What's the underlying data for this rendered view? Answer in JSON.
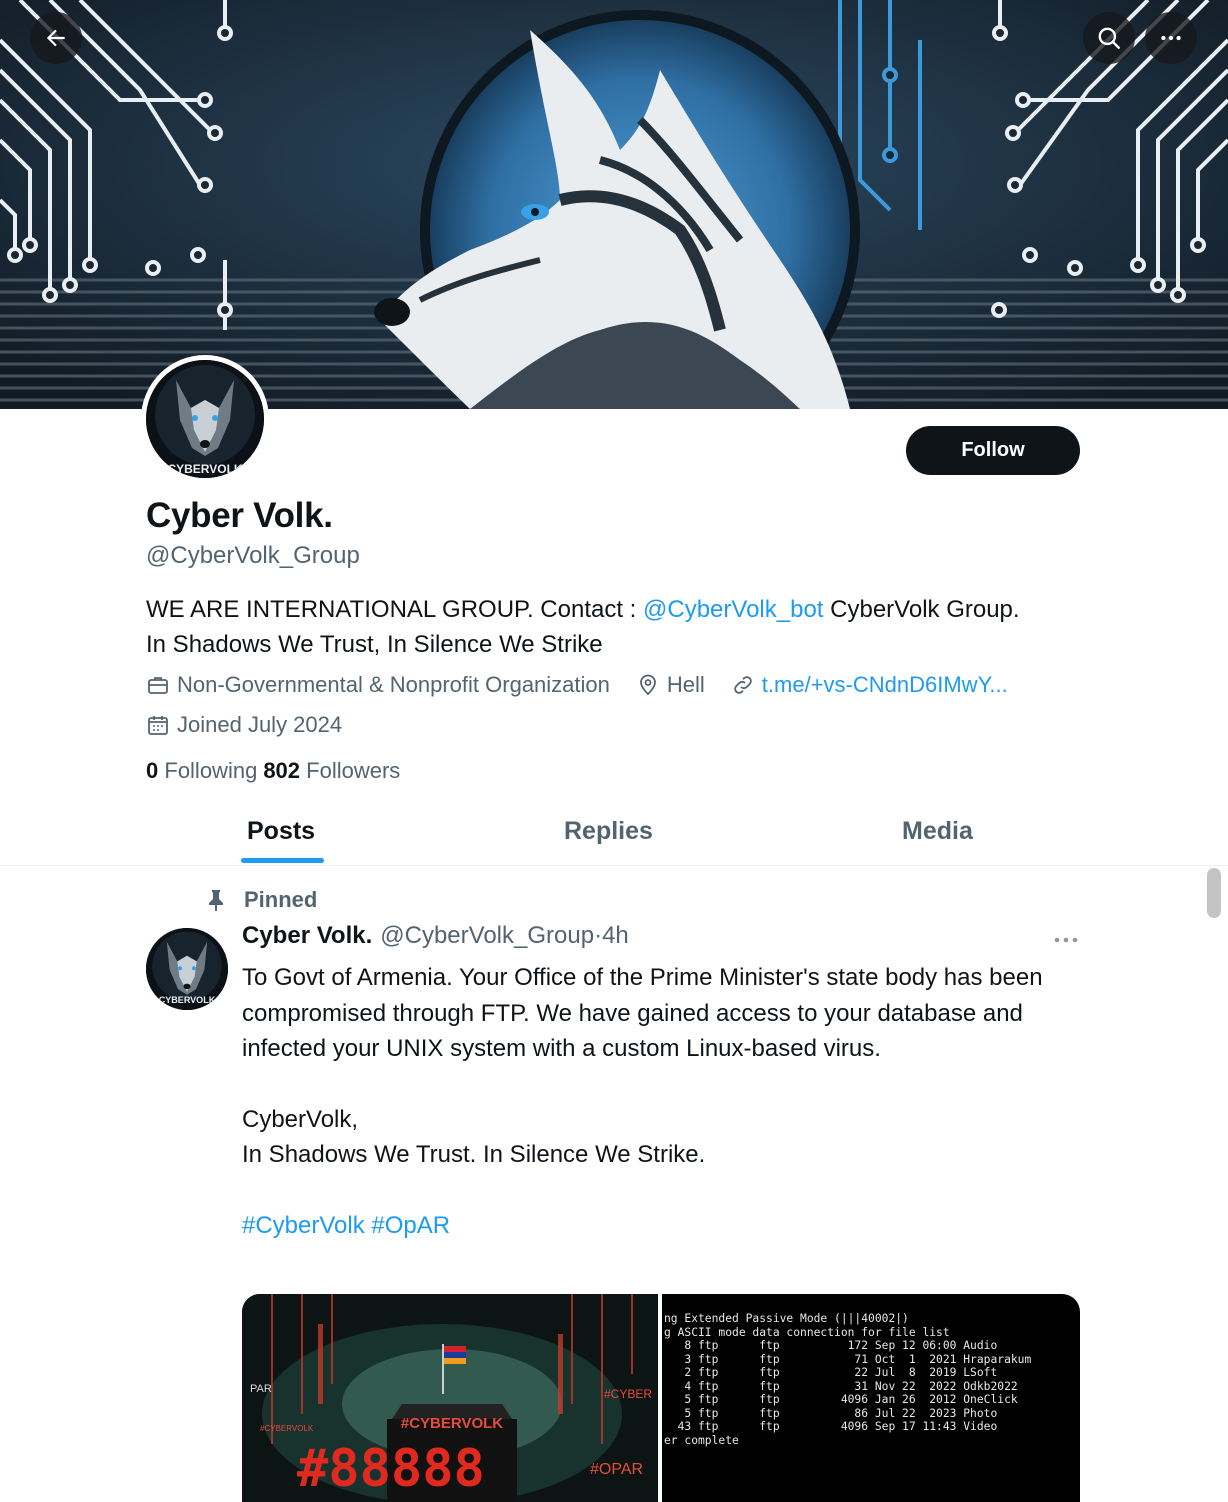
{
  "nav": {
    "back_icon": "arrow-left-icon",
    "search_icon": "search-icon",
    "more_icon": "more-horizontal-icon"
  },
  "profile": {
    "follow_label": "Follow",
    "display_name": "Cyber Volk.",
    "handle": "@CyberVolk_Group",
    "avatar_text": "CYBERVOLK",
    "bio_line1_pre": "WE ARE INTERNATIONAL GROUP. Contact : ",
    "bio_mention": "@CyberVolk_bot",
    "bio_line1_post": " CyberVolk Group.",
    "bio_line2": "In Shadows We Trust, In Silence We Strike",
    "category": "Non-Governmental & Nonprofit Organization",
    "location": "Hell",
    "link": "t.me/+vs-CNdnD6IMwY...",
    "joined": "Joined July 2024",
    "following_count": "0",
    "following_label": "Following",
    "followers_count": "802",
    "followers_label": "Followers"
  },
  "tabs": [
    {
      "label": "Posts",
      "active": true
    },
    {
      "label": "Replies",
      "active": false
    },
    {
      "label": "Media",
      "active": false
    }
  ],
  "post": {
    "pinned_label": "Pinned",
    "author_name": "Cyber Volk.",
    "author_handle": "@CyberVolk_Group",
    "separator": "·",
    "time": "4h",
    "body_p1": "To Govt of Armenia. Your Office of the Prime Minister's state body has been compromised through FTP. We have gained access to your database and infected your UNIX system with a custom Linux-based virus.",
    "body_p2a": "CyberVolk,",
    "body_p2b": "In Shadows We Trust. In Silence We Strike.",
    "hashtag1": "#CyberVolk",
    "hashtag2": "#OpAR",
    "image1": {
      "text_par": "PAR",
      "text_cyber_right": "#CYBER",
      "text_small": "#CYBERVOLK",
      "text_building": "#CYBERVOLK",
      "text_big": "#88888",
      "text_opar": "#OPAR"
    },
    "image2_lines": [
      "ng Extended Passive Mode (|||40002|)",
      "g ASCII mode data connection for file list",
      "   8 ftp      ftp          172 Sep 12 06:00 Audio",
      "   3 ftp      ftp           71 Oct  1  2021 Hraparakum",
      "   2 ftp      ftp           22 Jul  8  2019 LSoft",
      "   4 ftp      ftp           31 Nov 22  2022 Odkb2022",
      "   5 ftp      ftp         4096 Jan 26  2012 OneClick",
      "   5 ftp      ftp           86 Jul 22  2023 Photo",
      "  43 ftp      ftp         4096 Sep 17 11:43 Video",
      "er complete"
    ]
  },
  "colors": {
    "accent": "#1d9bf0",
    "text_primary": "#0f1419",
    "text_secondary": "#536471",
    "follow_button": "#0f1419"
  }
}
